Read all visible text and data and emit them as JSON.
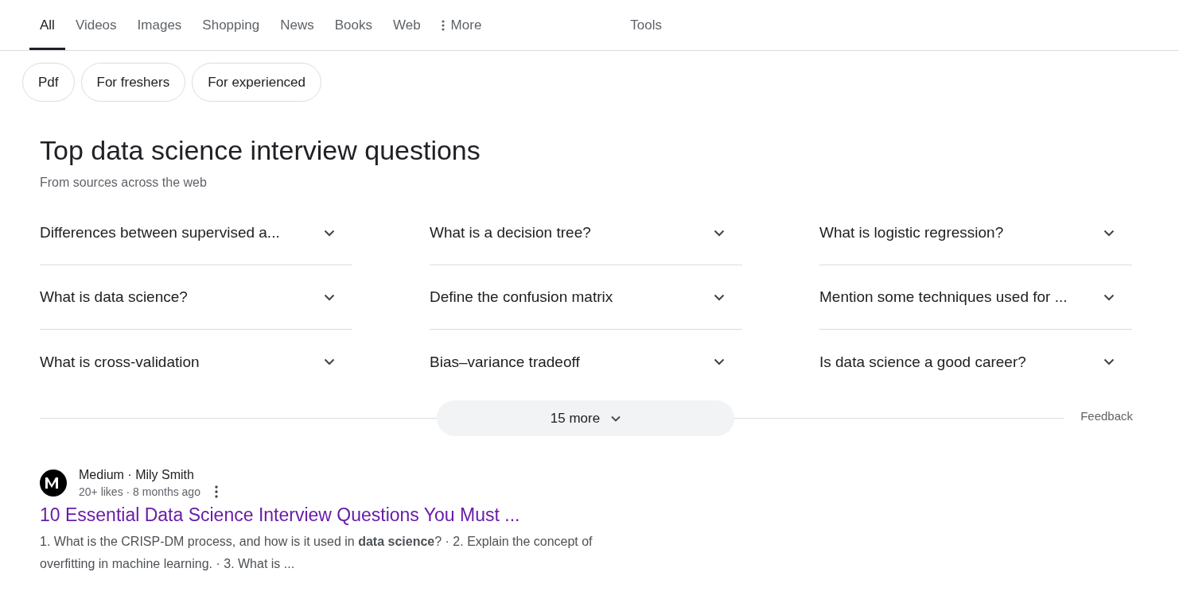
{
  "tabs": [
    {
      "label": "All",
      "selected": true
    },
    {
      "label": "Videos",
      "selected": false
    },
    {
      "label": "Images",
      "selected": false
    },
    {
      "label": "Shopping",
      "selected": false
    },
    {
      "label": "News",
      "selected": false
    },
    {
      "label": "Books",
      "selected": false
    },
    {
      "label": "Web",
      "selected": false
    },
    {
      "label": "More",
      "selected": false,
      "kind": "menu"
    }
  ],
  "tools": "Tools",
  "chips": [
    "Pdf",
    "For freshers",
    "For experienced"
  ],
  "questions_panel": {
    "title": "Top data science interview questions",
    "subtitle": "From sources across the web",
    "questions": [
      {
        "text": "Differences between supervised a...",
        "expanded": false
      },
      {
        "text": "What is a decision tree?",
        "expanded": false
      },
      {
        "text": "What is logistic regression?",
        "expanded": false
      },
      {
        "text": "What is data science?",
        "expanded": false
      },
      {
        "text": "Define the confusion matrix",
        "expanded": false
      },
      {
        "text": "Mention some techniques used for ...",
        "expanded": false
      },
      {
        "text": "What is cross-validation",
        "expanded": false
      },
      {
        "text": "Bias–variance tradeoff",
        "expanded": false
      },
      {
        "text": "Is data science a good career?",
        "expanded": false
      }
    ],
    "more_button": "15 more",
    "feedback": "Feedback"
  },
  "result": {
    "source": "Medium · Mily Smith",
    "meta": "20+ likes · 8 months ago",
    "title": "10 Essential Data Science Interview Questions You Must ...",
    "snippet": "1. What is the CRISP-DM process, and how is it used in **data science**? · 2. Explain the concept of overfitting in machine learning. · 3. What is ..."
  }
}
